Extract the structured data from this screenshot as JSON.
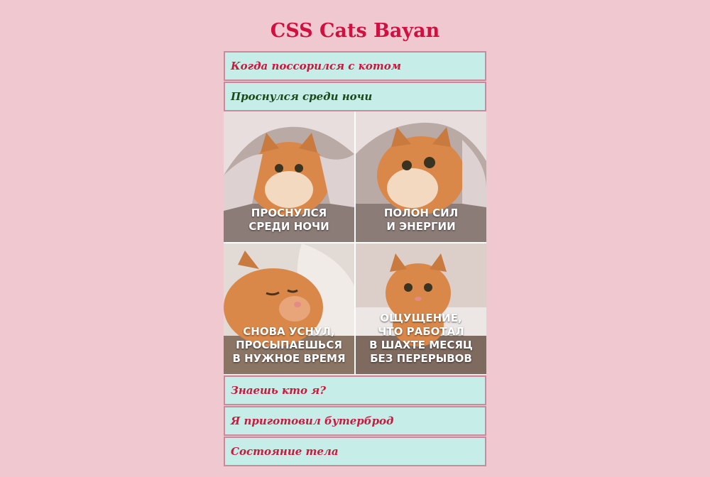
{
  "page": {
    "title": "CSS Cats Bayan"
  },
  "accordion": {
    "items": [
      {
        "label": "Когда поссорился с котом",
        "open": false
      },
      {
        "label": "Проснулся среди ночи",
        "open": true
      },
      {
        "label": "Знаешь кто я?",
        "open": false
      },
      {
        "label": "Я приготовил бутерброд",
        "open": false
      },
      {
        "label": "Состояние тела",
        "open": false
      }
    ],
    "open_panel": {
      "memes": [
        {
          "caption": "ПРОСНУЛСЯ\nСРЕДИ НОЧИ"
        },
        {
          "caption": "ПОЛОН СИЛ\nИ ЭНЕРГИИ"
        },
        {
          "caption": "СНОВА УСНУЛ,\nПРОСЫПАЕШЬСЯ\nВ НУЖНОЕ ВРЕМЯ"
        },
        {
          "caption": "ОЩУЩЕНИЕ,\nЧТО РАБОТАЛ\nВ ШАХТЕ МЕСЯЦ\nБЕЗ ПЕРЕРЫВОВ"
        }
      ]
    }
  },
  "colors": {
    "background": "#f0c8d0",
    "title": "#d01040",
    "header_bg": "#c6ede8",
    "header_border": "#c98b9c",
    "header_text": "#c81a3c",
    "header_text_open": "#1a4a1a",
    "cat_fur": "#d9884a"
  }
}
